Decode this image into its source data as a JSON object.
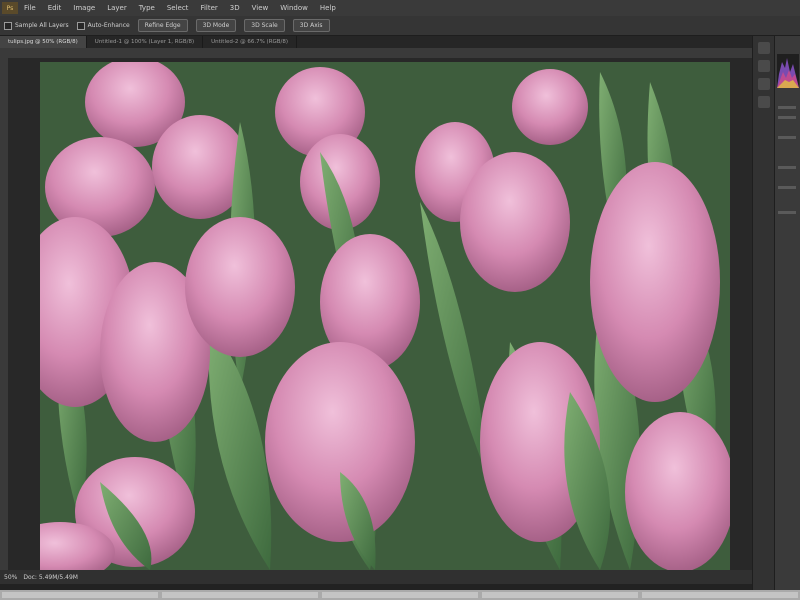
{
  "menubar": {
    "logo": "Ps",
    "items": [
      "File",
      "Edit",
      "Image",
      "Layer",
      "Type",
      "Select",
      "Filter",
      "3D",
      "View",
      "Window",
      "Help"
    ]
  },
  "options_bar": {
    "checkbox_label": "Sample All Layers",
    "checkbox2_label": "Auto-Enhance",
    "buttons": [
      "Refine Edge",
      "3D Mode",
      "3D Scale",
      "3D Axis"
    ]
  },
  "doc_tabs": [
    {
      "label": "tulips.jpg @ 50% (RGB/8)"
    },
    {
      "label": "Untitled-1 @ 100% (Layer 1, RGB/8)"
    },
    {
      "label": "Untitled-2 @ 66.7% (RGB/8)"
    }
  ],
  "status": {
    "zoom": "50%",
    "doc": "Doc: 5.49M/5.49M"
  },
  "colors": {
    "app_bg": "#2b2b2b",
    "panel_bg": "#3a3a3a",
    "tulip_pink": "#d78fb6",
    "leaf_green": "#5a8a55"
  },
  "icons": [
    "photoshop-logo-icon",
    "histogram-icon",
    "panel-collapse-icon"
  ]
}
